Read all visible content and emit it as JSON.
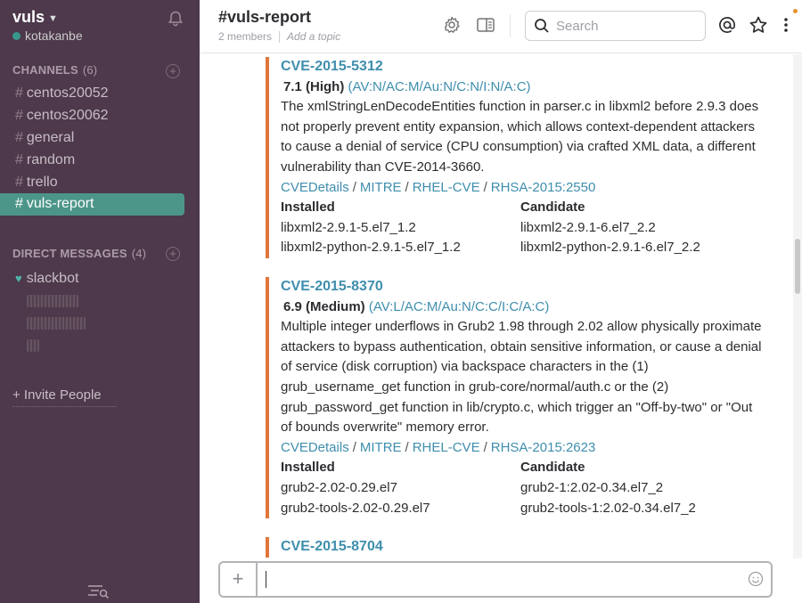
{
  "sidebar": {
    "team_name": "vuls",
    "user_name": "kotakanbe",
    "channels_heading": "CHANNELS",
    "channels_count": "(6)",
    "channels": [
      {
        "label": "centos20052"
      },
      {
        "label": "centos20062"
      },
      {
        "label": "general"
      },
      {
        "label": "random"
      },
      {
        "label": "trello"
      },
      {
        "label": "vuls-report",
        "active": true
      }
    ],
    "dm_heading": "DIRECT MESSAGES",
    "dm_count": "(4)",
    "dms": [
      {
        "label": "slackbot"
      }
    ],
    "invite_label": "+ Invite People"
  },
  "header": {
    "channel_title": "#vuls-report",
    "members": "2 members",
    "topic_placeholder": "Add a topic",
    "search_placeholder": "Search"
  },
  "attachments": [
    {
      "cve": "CVE-2015-5312",
      "score": "7.1 (High)",
      "vector": "(AV:N/AC:M/Au:N/C:N/I:N/A:C)",
      "description": "The xmlStringLenDecodeEntities function in parser.c in libxml2 before 2.9.3 does not properly prevent entity expansion, which allows context-dependent attackers to cause a denial of service (CPU consumption) via crafted XML data, a different vulnerability than CVE-2014-3660.",
      "links": [
        "CVEDetails",
        "MITRE",
        "RHEL-CVE",
        "RHSA-2015:2550"
      ],
      "installed_heading": "Installed",
      "candidate_heading": "Candidate",
      "packages": [
        {
          "installed": "libxml2-2.9.1-5.el7_1.2",
          "candidate": "libxml2-2.9.1-6.el7_2.2"
        },
        {
          "installed": "libxml2-python-2.9.1-5.el7_1.2",
          "candidate": "libxml2-python-2.9.1-6.el7_2.2"
        }
      ]
    },
    {
      "cve": "CVE-2015-8370",
      "score": "6.9 (Medium)",
      "vector": "(AV:L/AC:M/Au:N/C:C/I:C/A:C)",
      "description": "Multiple integer underflows in Grub2 1.98 through 2.02 allow physically proximate attackers to bypass authentication, obtain sensitive information, or cause a denial of service (disk corruption) via backspace characters in the (1) grub_username_get function in grub-core/normal/auth.c or the (2) grub_password_get function in lib/crypto.c, which trigger an \"Off-by-two\" or \"Out of bounds overwrite\" memory error.",
      "links": [
        "CVEDetails",
        "MITRE",
        "RHEL-CVE",
        "RHSA-2015:2623"
      ],
      "installed_heading": "Installed",
      "candidate_heading": "Candidate",
      "packages": [
        {
          "installed": "grub2-2.02-0.29.el7",
          "candidate": "grub2-1:2.02-0.34.el7_2"
        },
        {
          "installed": "grub2-tools-2.02-0.29.el7",
          "candidate": "grub2-tools-1:2.02-0.34.el7_2"
        }
      ]
    },
    {
      "cve": "CVE-2015-8704"
    }
  ],
  "colors": {
    "sidebar_bg": "#4d394b",
    "active_channel": "#4c9689",
    "attachment_bar": "#e0763a",
    "link": "#3f8ead"
  },
  "icons": [
    "bell-icon",
    "gear-icon",
    "sidebar-toggle-icon",
    "search-icon",
    "at-icon",
    "star-icon",
    "more-vertical-icon",
    "filter-list-icon",
    "plus-icon",
    "emoji-icon"
  ]
}
